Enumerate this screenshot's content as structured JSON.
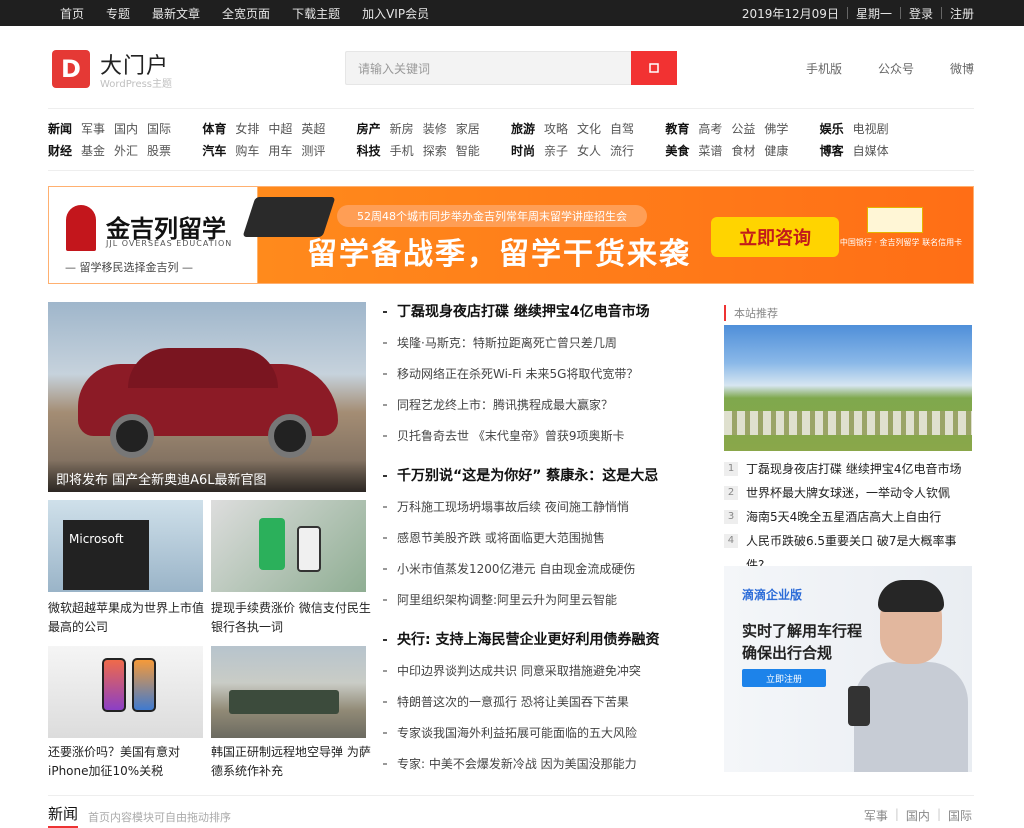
{
  "topbar": {
    "nav": [
      "首页",
      "专题",
      "最新文章",
      "全宽页面",
      "下载主题",
      "加入VIP会员"
    ],
    "date": "2019年12月09日",
    "weekday": "星期一",
    "login": "登录",
    "register": "注册"
  },
  "header": {
    "logo_letter": "D",
    "site_name": "大门户",
    "site_sub": "WordPress主题",
    "search_placeholder": "请输入关键词",
    "search_icon": "search-icon",
    "links": [
      "手机版",
      "公众号",
      "微博"
    ]
  },
  "categories": [
    {
      "rows": [
        [
          {
            "t": "新闻",
            "main": true
          },
          {
            "t": "军事"
          },
          {
            "t": "国内"
          },
          {
            "t": "国际"
          }
        ],
        [
          {
            "t": "财经",
            "main": true
          },
          {
            "t": "基金"
          },
          {
            "t": "外汇"
          },
          {
            "t": "股票"
          }
        ]
      ]
    },
    {
      "rows": [
        [
          {
            "t": "体育",
            "main": true
          },
          {
            "t": "女排"
          },
          {
            "t": "中超"
          },
          {
            "t": "英超"
          }
        ],
        [
          {
            "t": "汽车",
            "main": true
          },
          {
            "t": "购车"
          },
          {
            "t": "用车"
          },
          {
            "t": "测评"
          }
        ]
      ]
    },
    {
      "rows": [
        [
          {
            "t": "房产",
            "main": true
          },
          {
            "t": "新房"
          },
          {
            "t": "装修"
          },
          {
            "t": "家居"
          }
        ],
        [
          {
            "t": "科技",
            "main": true
          },
          {
            "t": "手机"
          },
          {
            "t": "探索"
          },
          {
            "t": "智能"
          }
        ]
      ]
    },
    {
      "rows": [
        [
          {
            "t": "旅游",
            "main": true
          },
          {
            "t": "攻略"
          },
          {
            "t": "文化"
          },
          {
            "t": "自驾"
          }
        ],
        [
          {
            "t": "时尚",
            "main": true
          },
          {
            "t": "亲子"
          },
          {
            "t": "女人"
          },
          {
            "t": "流行"
          }
        ]
      ]
    },
    {
      "rows": [
        [
          {
            "t": "教育",
            "main": true
          },
          {
            "t": "高考"
          },
          {
            "t": "公益"
          },
          {
            "t": "佛学"
          }
        ],
        [
          {
            "t": "美食",
            "main": true
          },
          {
            "t": "菜谱"
          },
          {
            "t": "食材"
          },
          {
            "t": "健康"
          }
        ]
      ]
    },
    {
      "rows": [
        [
          {
            "t": "娱乐",
            "main": true
          },
          {
            "t": "电视剧"
          }
        ],
        [
          {
            "t": "博客",
            "main": true
          },
          {
            "t": "自媒体"
          }
        ]
      ]
    }
  ],
  "banner": {
    "brand_name": "金吉列留学",
    "brand_sub": "JJL OVERSEAS EDUCATION",
    "brand_slogan": "— 留学移民选择金吉列 —",
    "pill_text": "52周48个城市同步举办金吉列常年周末留学讲座招生会",
    "headline": "留学备战季，留学干货来袭",
    "cta": "立即咨询",
    "card_text": "中国银行 · 金吉列留学 联名信用卡"
  },
  "hero": {
    "caption": "即将发布 国产全新奥迪A6L最新官图"
  },
  "thumbs": [
    {
      "caption": "微软超越苹果成为世界上市值最高的公司",
      "sign": "Microsoft"
    },
    {
      "caption": "提现手续费涨价 微信支付民生银行各执一词"
    },
    {
      "caption": "还要涨价吗？美国有意对iPhone加征10%关税"
    },
    {
      "caption": "韩国正研制远程地空导弹 为萨德系统作补充"
    }
  ],
  "mid_columns": [
    {
      "headline": "丁磊现身夜店打碟 继续押宝4亿电音市场",
      "items": [
        "埃隆·马斯克：特斯拉距离死亡曾只差几周",
        "移动网络正在杀死Wi-Fi 未来5G将取代宽带？",
        "同程艺龙终上市：腾讯携程成最大赢家？",
        "贝托鲁奇去世 《末代皇帝》曾获9项奥斯卡"
      ]
    },
    {
      "headline": "千万别说“这是为你好” 蔡康永：这是大忌",
      "items": [
        "万科施工现场坍塌事故后续 夜间施工静悄悄",
        "感恩节美股齐跌 或将面临更大范围抛售",
        "小米市值蒸发1200亿港元 自由现金流成硬伤",
        "阿里组织架构调整:阿里云升为阿里云智能"
      ]
    },
    {
      "headline": "央行: 支持上海民营企业更好利用债券融资",
      "items": [
        "中印边界谈判达成共识 同意采取措施避免冲突",
        "特朗普这次的一意孤行 恐将让美国吞下苦果",
        "专家谈我国海外利益拓展可能面临的五大风险",
        "专家: 中美不会爆发新冷战 因为美国没那能力"
      ]
    }
  ],
  "recommend": {
    "title": "本站推荐",
    "items": [
      {
        "num": "1",
        "text": "丁磊现身夜店打碟 继续押宝4亿电音市场"
      },
      {
        "num": "2",
        "text": "世界杯最大牌女球迷，一举动令人钦佩"
      },
      {
        "num": "3",
        "text": "海南5天4晚全五星酒店高大上自由行"
      },
      {
        "num": "4",
        "text": "人民币跌破6.5重要关口 破7是大概率事件?"
      }
    ]
  },
  "ad2": {
    "brand": "滴滴企业版",
    "slogan": "实时了解用车行程 确保出行合规",
    "button": "立即注册"
  },
  "bottom": {
    "title": "新闻",
    "desc": "首页内容模块可自由拖动排序",
    "links": [
      "军事",
      "国内",
      "国际"
    ]
  },
  "colors": {
    "accent": "#f23232",
    "topbar": "#1f1f1f",
    "banner_orange": "#ff6e16"
  }
}
